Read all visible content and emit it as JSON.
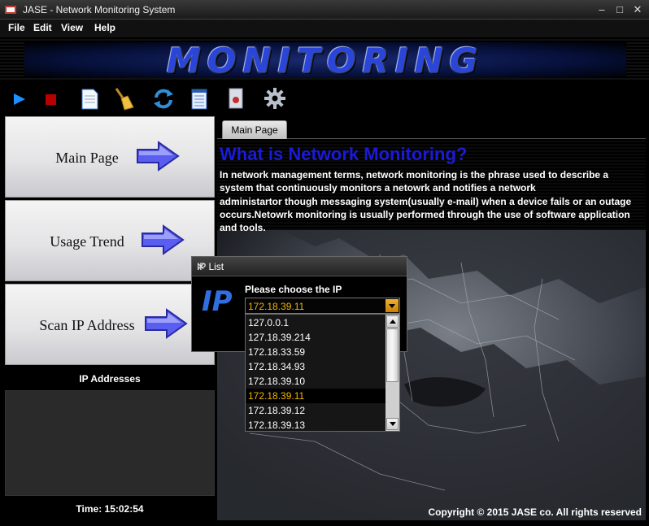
{
  "window": {
    "title": "JASE - Network Monitoring System"
  },
  "menu": [
    "File",
    "Edit",
    "View",
    "Help"
  ],
  "banner": {
    "text": "MONITORING"
  },
  "toolbar": [
    "play-icon",
    "stop-icon",
    "document-icon",
    "broom-icon",
    "refresh-icon",
    "notepad-icon",
    "document-view-icon",
    "gear-icon"
  ],
  "sidebar": {
    "buttons": [
      {
        "label": "Main Page"
      },
      {
        "label": "Usage Trend"
      },
      {
        "label": "Scan IP Address"
      }
    ],
    "ip_header": "IP Addresses",
    "time": "Time: 15:02:54"
  },
  "main": {
    "tab": "Main Page",
    "heading": "What is Network Monitoring?",
    "lines": [
      "In network management terms, network monitoring is the phrase used to describe a",
      "system that continuously monitors a netowrk and notifies a network",
      "administartor though messaging system(usually e-mail) when a device fails or an outage",
      "occurs.Netowrk monitoring is usually performed through the use of software application",
      "and tools."
    ],
    "copyright": "Copyright © 2015 JASE co.  All rights reserved"
  },
  "dialog": {
    "title": "IP List",
    "logo_text": "IP",
    "prompt": "Please choose the IP",
    "selected": "172.18.39.11",
    "options": [
      "127.0.0.1",
      "127.18.39.214",
      "172.18.33.59",
      "172.18.34.93",
      "172.18.39.10",
      "172.18.39.11",
      "172.18.39.12",
      "172.18.39.13"
    ]
  },
  "colors": {
    "accent": "#f4b400",
    "heading": "#1a1ad8",
    "banner": "#2a45d8"
  }
}
